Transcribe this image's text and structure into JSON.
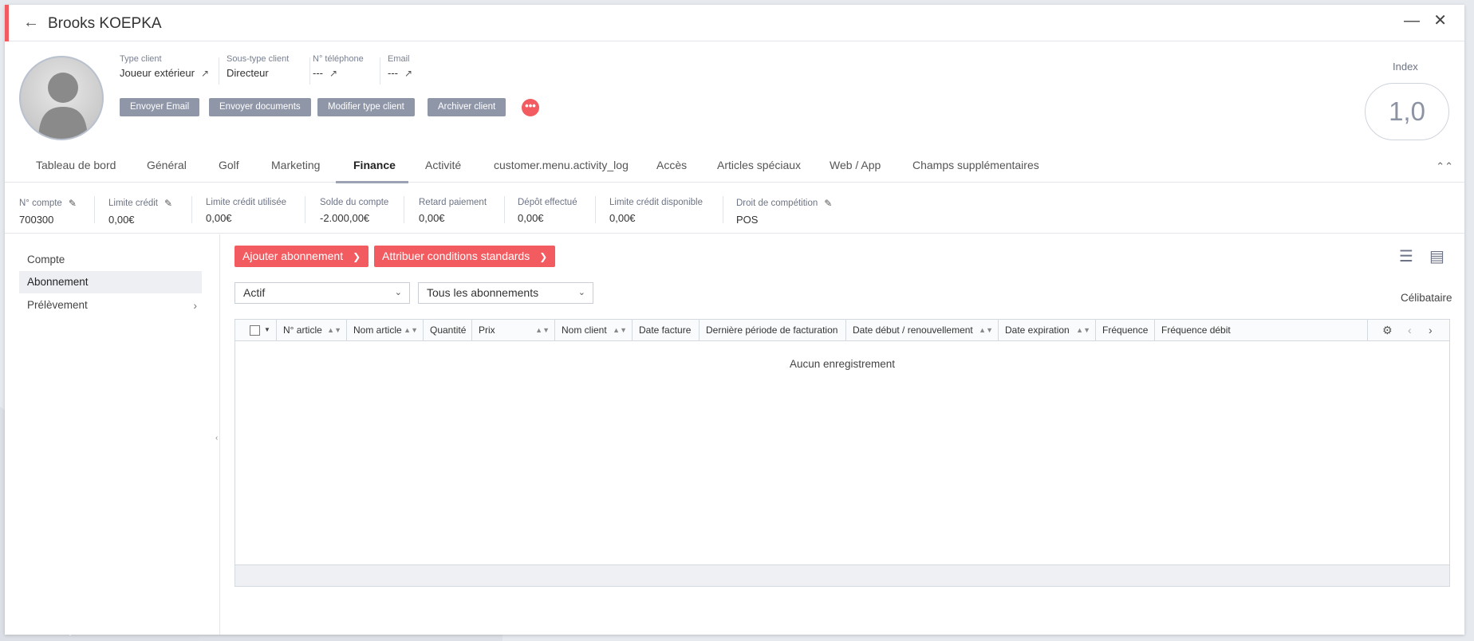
{
  "window": {
    "title": "Brooks KOEPKA",
    "minimize_icon": "minimize-icon",
    "close_icon": "close-icon"
  },
  "header": {
    "fields": [
      {
        "label": "Type client",
        "value": "Joueur extérieur"
      },
      {
        "label": "Sous-type client",
        "value": "Directeur"
      },
      {
        "label": "N° téléphone",
        "value": "---"
      },
      {
        "label": "Email",
        "value": "---"
      }
    ],
    "buttons": {
      "send_email": "Envoyer Email",
      "send_documents": "Envoyer documents",
      "modify_type": "Modifier type client",
      "archive": "Archiver client",
      "more": "•••"
    },
    "index_label": "Index",
    "index_value": "1,0"
  },
  "tabs": [
    "Tableau de bord",
    "Général",
    "Golf",
    "Marketing",
    "Finance",
    "Activité",
    "customer.menu.activity_log",
    "Accès",
    "Articles spéciaux",
    "Web / App",
    "Champs supplémentaires"
  ],
  "active_tab": "Finance",
  "finance": [
    {
      "label": "N° compte",
      "value": "700300"
    },
    {
      "label": "Limite crédit",
      "value": "0,00€"
    },
    {
      "label": "Limite crédit utilisée",
      "value": "0,00€"
    },
    {
      "label": "Solde du compte",
      "value": "-2.000,00€"
    },
    {
      "label": "Retard paiement",
      "value": "0,00€"
    },
    {
      "label": "Dépôt effectué",
      "value": "0,00€"
    },
    {
      "label": "Limite crédit disponible",
      "value": "0,00€"
    },
    {
      "label": "Droit de compétition",
      "value": "POS"
    }
  ],
  "sidebar": {
    "items": [
      {
        "label": "Compte"
      },
      {
        "label": "Abonnement"
      },
      {
        "label": "Prélèvement"
      }
    ],
    "active": "Abonnement"
  },
  "actions": {
    "add_subscription": "Ajouter abonnement",
    "assign_conditions": "Attribuer conditions standards"
  },
  "filters": {
    "status": "Actif",
    "type": "Tous les abonnements"
  },
  "status_text": "Célibataire",
  "table": {
    "columns": [
      "N° article",
      "Nom article",
      "Quantité",
      "Prix",
      "Nom client",
      "Date facture",
      "Dernière période de facturation",
      "Date début / renouvellement",
      "Date expiration",
      "Fréquence",
      "Fréquence débit"
    ],
    "empty_text": "Aucun enregistrement"
  },
  "colors": {
    "accent": "#f25c60",
    "button_grey": "#8f96a8"
  }
}
